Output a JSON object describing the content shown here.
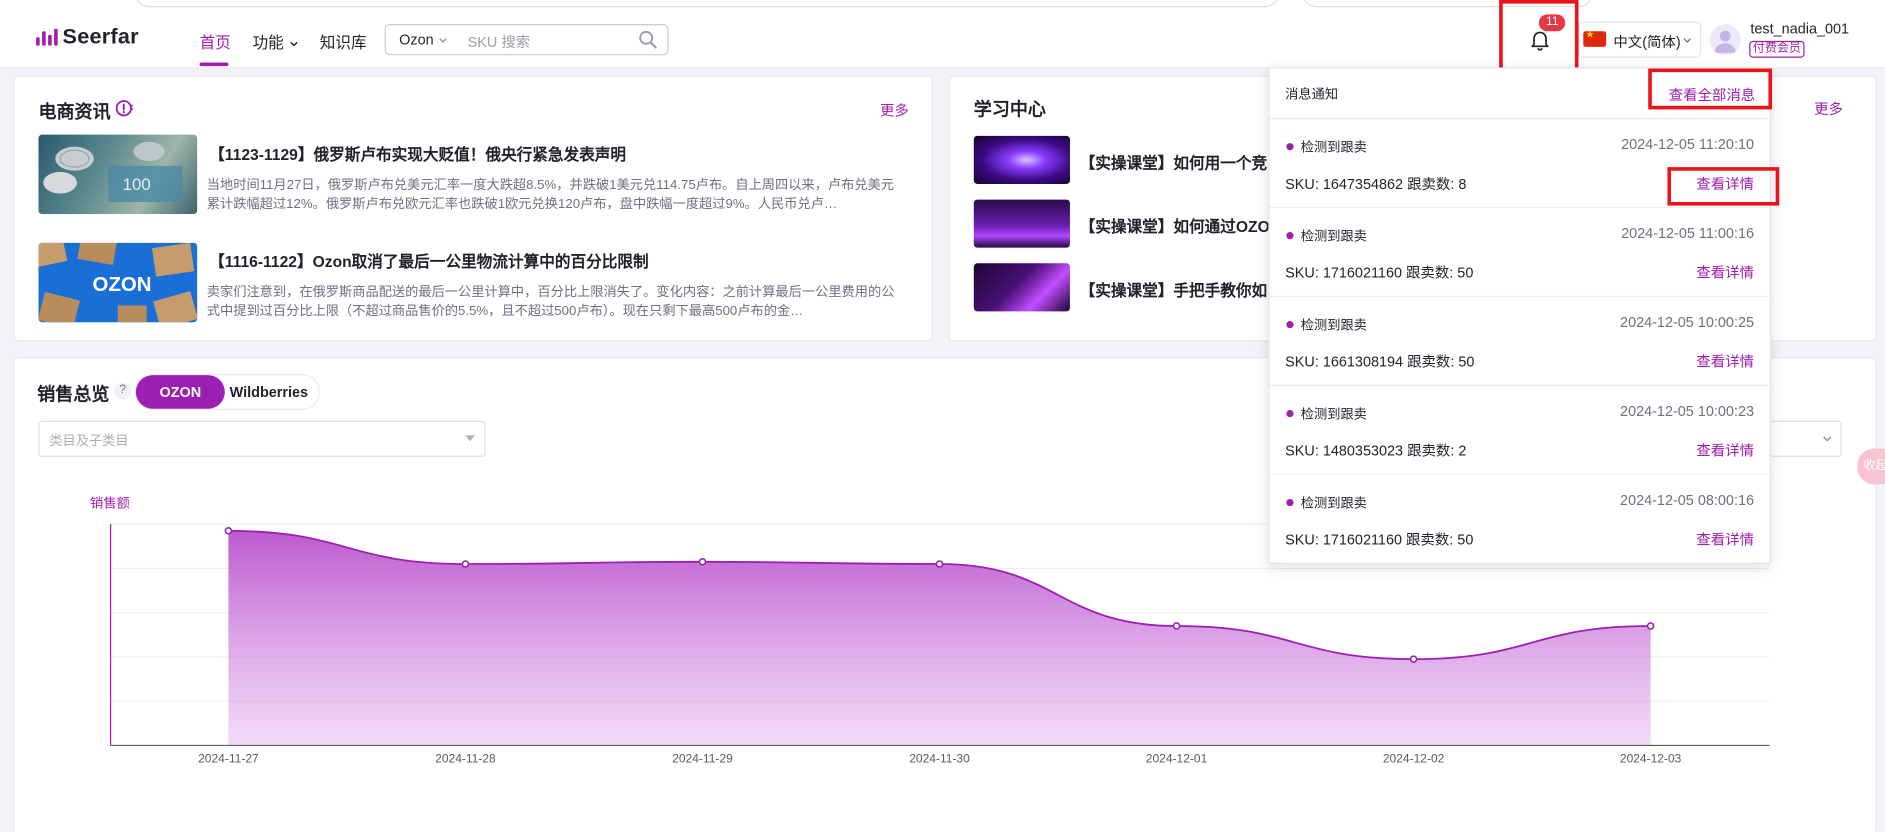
{
  "header": {
    "brand": "Seerfar",
    "nav": {
      "home": "首页",
      "features": "功能",
      "knowledge": "知识库"
    },
    "search": {
      "platform": "Ozon",
      "placeholder": "SKU 搜索"
    },
    "notifications_badge": "11",
    "language": "中文(简体)",
    "user": {
      "name": "test_nadia_001",
      "tier": "付费会员"
    }
  },
  "news": {
    "title": "电商资讯",
    "more": "更多",
    "items": [
      {
        "title": "【1123-1129】俄罗斯卢布实现大贬值！俄央行紧急发表声明",
        "desc": "当地时间11月27日，俄罗斯卢布兑美元汇率一度大跌超8.5%，并跌破1美元兑114.75卢布。自上周四以来，卢布兑美元累计跌幅超过12%。俄罗斯卢布兑欧元汇率也跌破1欧元兑换120卢布，盘中跌幅一度超过9%。人民币兑卢…"
      },
      {
        "title": "【1116-1122】Ozon取消了最后一公里物流计算中的百分比限制",
        "desc": "卖家们注意到，在俄罗斯商品配送的最后一公里计算中，百分比上限消失了。变化内容：之前计算最后一公里费用的公式中提到过百分比上限（不超过商品售价的5.5%，且不超过500卢布）。现在只剩下最高500卢布的金…"
      }
    ]
  },
  "learning": {
    "title": "学习中心",
    "more": "更多",
    "items": [
      {
        "title": "【实操课堂】如何用一个竞"
      },
      {
        "title": "【实操课堂】如何通过OZO"
      },
      {
        "title": "【实操课堂】手把手教你如"
      }
    ]
  },
  "sales": {
    "title": "销售总览",
    "help": "?",
    "platforms": {
      "active": "OZON",
      "inactive": "Wildberries"
    },
    "category_placeholder": "类目及子类目",
    "side_float": "收起"
  },
  "notifications": {
    "title": "消息通知",
    "view_all": "查看全部消息",
    "items": [
      {
        "type": "检测到跟卖",
        "time": "2024-12-05 11:20:10",
        "sku": "SKU: 1647354862 跟卖数: 8",
        "detail": "查看详情"
      },
      {
        "type": "检测到跟卖",
        "time": "2024-12-05 11:00:16",
        "sku": "SKU: 1716021160 跟卖数: 50",
        "detail": "查看详情"
      },
      {
        "type": "检测到跟卖",
        "time": "2024-12-05 10:00:25",
        "sku": "SKU: 1661308194 跟卖数: 50",
        "detail": "查看详情"
      },
      {
        "type": "检测到跟卖",
        "time": "2024-12-05 10:00:23",
        "sku": "SKU: 1480353023 跟卖数: 2",
        "detail": "查看详情"
      },
      {
        "type": "检测到跟卖",
        "time": "2024-12-05 08:00:16",
        "sku": "SKU: 1716021160 跟卖数: 50",
        "detail": "查看详情"
      }
    ]
  },
  "colors": {
    "accent": "#a21caf",
    "highlight_box": "#e8141a"
  },
  "chart_data": {
    "type": "area",
    "ylabel": "销售额",
    "x": [
      "2024-11-27",
      "2024-11-28",
      "2024-11-29",
      "2024-11-30",
      "2024-12-01",
      "2024-12-02",
      "2024-12-03"
    ],
    "series": [
      {
        "values": [
          97,
          82,
          83,
          82,
          54,
          39,
          54
        ]
      }
    ],
    "ylim": [
      0,
      100
    ],
    "grid": true
  }
}
